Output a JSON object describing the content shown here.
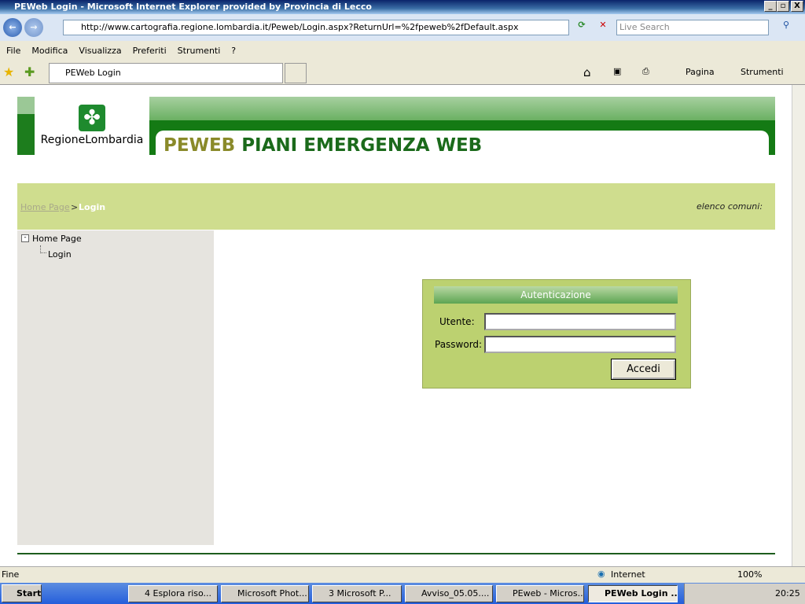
{
  "window": {
    "title": "PEWeb Login - Microsoft Internet Explorer provided by Provincia di Lecco"
  },
  "browser": {
    "url": "http://www.cartografia.regione.lombardia.it/Peweb/Login.aspx?ReturnUrl=%2fpeweb%2fDefault.aspx",
    "search_placeholder": "Live Search",
    "menu": [
      "File",
      "Modifica",
      "Visualizza",
      "Preferiti",
      "Strumenti",
      "?"
    ],
    "tab_label": "PEWeb Login",
    "cmd_page": "Pagina",
    "cmd_tools": "Strumenti"
  },
  "page": {
    "logo_text": "RegioneLombardia",
    "title_prefix": "PEWEB",
    "title_rest": "PIANI EMERGENZA WEB",
    "breadcrumb": {
      "home": "Home Page",
      "sep": ">",
      "current": "Login"
    },
    "elenco": "elenco comuni:",
    "tree": [
      {
        "label": "Home Page"
      },
      {
        "label": "Login"
      }
    ],
    "login": {
      "header": "Autenticazione",
      "user_label": "Utente:",
      "password_label": "Password:",
      "user_value": "",
      "password_value": "",
      "submit": "Accedi"
    }
  },
  "status": {
    "text": "Fine",
    "zone": "Internet",
    "zoom": "100%"
  },
  "taskbar": {
    "start": "Start",
    "tasks": [
      "4 Esplora riso...",
      "Microsoft Phot...",
      "3 Microsoft P...",
      "Avviso_05.05....",
      "PEweb - Micros...",
      "PEWeb Login ..."
    ],
    "clock": "20:25"
  }
}
